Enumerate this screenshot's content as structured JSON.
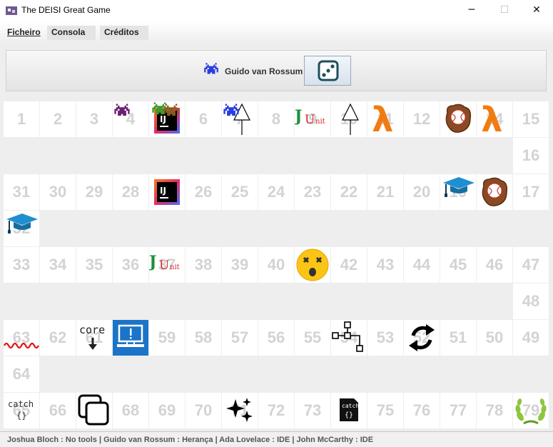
{
  "window": {
    "title": "The DEISI Great Game",
    "minimize_label": "─",
    "maximize_label": "☐",
    "close_label": "✕"
  },
  "menu": [
    {
      "label": "Ficheiro"
    },
    {
      "label": "Consola"
    },
    {
      "label": "Créditos"
    }
  ],
  "current_player": {
    "name": "Guido van Rossum",
    "avatar_icon": "space-invader-blue"
  },
  "status": "Joshua Bloch : No tools | Guido van Rossum : Herança | Ada Lovelace : IDE | John McCarthy : IDE",
  "colors": {
    "cell": "#ffffff",
    "number": "#d3d3d3",
    "background": "#eeeeee"
  },
  "board": {
    "cells": [
      "1",
      "2",
      "3",
      "4",
      "5",
      "6",
      "7",
      "8",
      "9",
      "10",
      "11",
      "12",
      "13",
      "14",
      "15",
      "16",
      "17",
      "18",
      "19",
      "20",
      "21",
      "22",
      "23",
      "24",
      "25",
      "26",
      "27",
      "28",
      "29",
      "30",
      "31",
      "32",
      "33",
      "34",
      "35",
      "36",
      "37",
      "38",
      "39",
      "40",
      "41",
      "42",
      "43",
      "44",
      "45",
      "46",
      "47",
      "48",
      "49",
      "50",
      "51",
      "52",
      "53",
      "54",
      "55",
      "56",
      "57",
      "58",
      "59",
      "60",
      "61",
      "62",
      "63",
      "64",
      "65",
      "66",
      "67",
      "68",
      "69",
      "70",
      "71",
      "72",
      "73",
      "74",
      "75",
      "76",
      "77",
      "78",
      "79"
    ],
    "tools": {
      "4": "space-invader-purple",
      "5": "intellij-ide-icon",
      "7": "inheritance-arrow-icon",
      "9": "junit-icon",
      "10": "inheritance-arrow-icon",
      "11": "lambda-icon",
      "13": "baseball-glove-icon",
      "14": "lambda-icon",
      "18": "baseball-glove-icon",
      "19": "graduation-cap-icon",
      "27": "intellij-ide-icon",
      "32": "graduation-cap-icon",
      "37": "junit-icon",
      "41": "dizzy-face-icon",
      "54": "tree-structure-icon",
      "52": "refresh-cycle-icon",
      "60": "blue-screen-icon",
      "61": "core-download-icon",
      "63": "squiggle-bug-icon",
      "65": "catch-block-icon",
      "67": "copy-windows-icon",
      "71": "sparkles-icon",
      "74": "catch-file-icon",
      "79": "laurel-wreath-icon"
    },
    "players": [
      {
        "name": "Guido van Rossum",
        "cell": "7",
        "icon": "space-invader-blue"
      },
      {
        "name": "Ada Lovelace",
        "cell": "5",
        "icon": "space-invader-green"
      },
      {
        "name": "John McCarthy",
        "cell": "5",
        "icon": "space-invader-brown"
      }
    ]
  }
}
